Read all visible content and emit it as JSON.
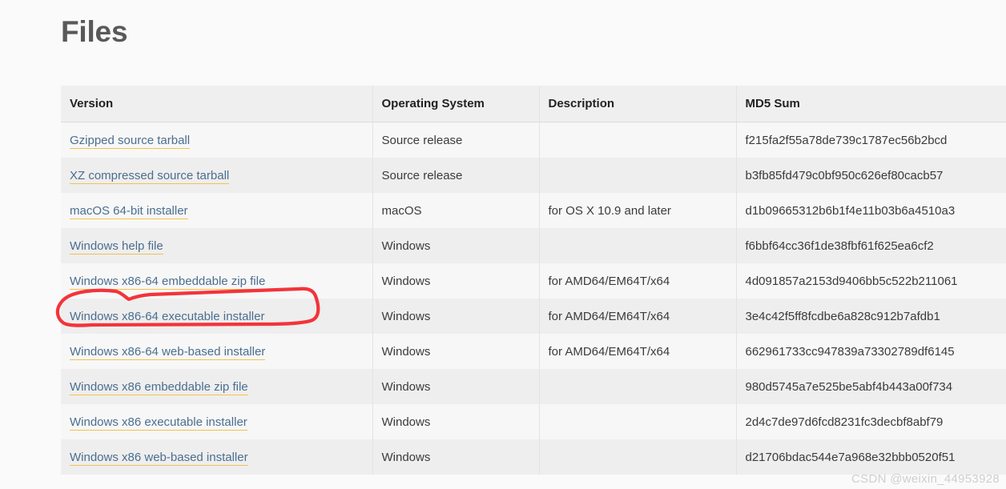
{
  "heading": "Files",
  "table": {
    "columns": [
      "Version",
      "Operating System",
      "Description",
      "MD5 Sum"
    ],
    "rows": [
      {
        "version": "Gzipped source tarball",
        "os": "Source release",
        "description": "",
        "md5": "f215fa2f55a78de739c1787ec56b2bcd"
      },
      {
        "version": "XZ compressed source tarball",
        "os": "Source release",
        "description": "",
        "md5": "b3fb85fd479c0bf950c626ef80cacb57"
      },
      {
        "version": "macOS 64-bit installer",
        "os": "macOS",
        "description": "for OS X 10.9 and later",
        "md5": "d1b09665312b6b1f4e11b03b6a4510a3"
      },
      {
        "version": "Windows help file",
        "os": "Windows",
        "description": "",
        "md5": "f6bbf64cc36f1de38fbf61f625ea6cf2"
      },
      {
        "version": "Windows x86-64 embeddable zip file",
        "os": "Windows",
        "description": "for AMD64/EM64T/x64",
        "md5": "4d091857a2153d9406bb5c522b211061"
      },
      {
        "version": "Windows x86-64 executable installer",
        "os": "Windows",
        "description": "for AMD64/EM64T/x64",
        "md5": "3e4c42f5ff8fcdbe6a828c912b7afdb1"
      },
      {
        "version": "Windows x86-64 web-based installer",
        "os": "Windows",
        "description": "for AMD64/EM64T/x64",
        "md5": "662961733cc947839a73302789df6145"
      },
      {
        "version": "Windows x86 embeddable zip file",
        "os": "Windows",
        "description": "",
        "md5": "980d5745a7e525be5abf4b443a00f734"
      },
      {
        "version": "Windows x86 executable installer",
        "os": "Windows",
        "description": "",
        "md5": "2d4c7de97d6fcd8231fc3decbf8abf79"
      },
      {
        "version": "Windows x86 web-based installer",
        "os": "Windows",
        "description": "",
        "md5": "d21706bdac544e7a968e32bbb0520f51"
      }
    ]
  },
  "annotation": {
    "target_row_index": 5,
    "shape": "hand-drawn-red-ellipse",
    "color": "#f4333a"
  },
  "watermark": "CSDN @weixin_44953928",
  "colors": {
    "link": "#4b6e8f",
    "link_underline": "#f2c14e",
    "heading": "#595959",
    "header_bg": "#efefef",
    "row_odd_bg": "#f7f7f7",
    "row_even_bg": "#eeeeee",
    "page_bg": "#fafafa"
  }
}
